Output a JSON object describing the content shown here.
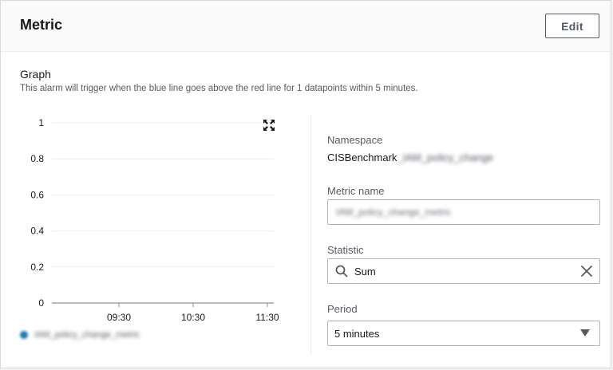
{
  "header": {
    "title": "Metric",
    "edit_label": "Edit"
  },
  "graph": {
    "label": "Graph",
    "description": "This alarm will trigger when the blue line goes above the red line for 1 datapoints within 5 minutes.",
    "legend_label": "IAM_policy_change_metric",
    "legend_color": "#1f77b4"
  },
  "chart_data": {
    "type": "line",
    "x": [
      "09:30",
      "10:30",
      "11:30"
    ],
    "ylim": [
      0,
      1
    ],
    "yticks": [
      "0",
      "0.2",
      "0.4",
      "0.6",
      "0.8",
      "1"
    ],
    "series": [
      {
        "values": []
      }
    ],
    "grid": true
  },
  "details": {
    "namespace_label": "Namespace",
    "namespace_prefix": "CISBenchmark",
    "namespace_blurred": "_IAM_policy_change",
    "metric_name_label": "Metric name",
    "metric_name_value": "IAM_policy_change_metric",
    "statistic_label": "Statistic",
    "statistic_value": "Sum",
    "period_label": "Period",
    "period_value": "5 minutes"
  },
  "icons": {
    "expand": "expand-icon",
    "search": "search-icon",
    "clear": "close-icon",
    "caret": "caret-down-icon"
  }
}
